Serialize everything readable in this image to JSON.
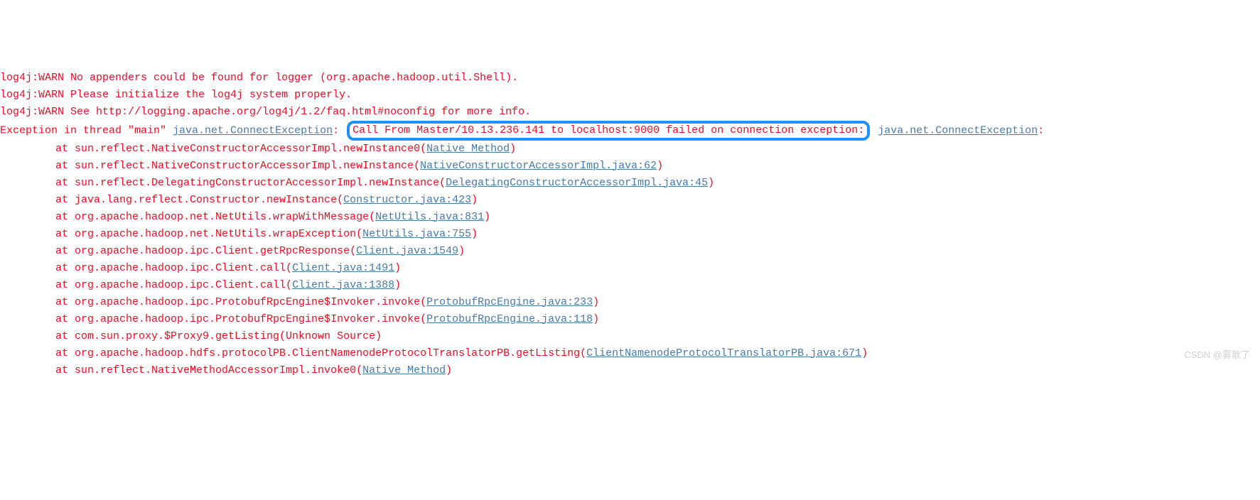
{
  "lines": {
    "warn1": "log4j:WARN No appenders could be found for logger (org.apache.hadoop.util.Shell).",
    "warn2": "log4j:WARN Please initialize the log4j system properly.",
    "warn3": "log4j:WARN See http://logging.apache.org/log4j/1.2/faq.html#noconfig for more info.",
    "exception": {
      "prefix": "Exception in thread \"main\" ",
      "link1": "java.net.ConnectException",
      "colon1": ": ",
      "highlighted": "Call From Master/10.13.236.141 to localhost:9000 failed on connection exception:",
      "space": " ",
      "link2": "java.net.ConnectException",
      "colon2": ":"
    },
    "stack": [
      {
        "at": "at sun.reflect.NativeConstructorAccessorImpl.newInstance0(",
        "link": "Native Method",
        "close": ")"
      },
      {
        "at": "at sun.reflect.NativeConstructorAccessorImpl.newInstance(",
        "link": "NativeConstructorAccessorImpl.java:62",
        "close": ")"
      },
      {
        "at": "at sun.reflect.DelegatingConstructorAccessorImpl.newInstance(",
        "link": "DelegatingConstructorAccessorImpl.java:45",
        "close": ")"
      },
      {
        "at": "at java.lang.reflect.Constructor.newInstance(",
        "link": "Constructor.java:423",
        "close": ")"
      },
      {
        "at": "at org.apache.hadoop.net.NetUtils.wrapWithMessage(",
        "link": "NetUtils.java:831",
        "close": ")"
      },
      {
        "at": "at org.apache.hadoop.net.NetUtils.wrapException(",
        "link": "NetUtils.java:755",
        "close": ")"
      },
      {
        "at": "at org.apache.hadoop.ipc.Client.getRpcResponse(",
        "link": "Client.java:1549",
        "close": ")"
      },
      {
        "at": "at org.apache.hadoop.ipc.Client.call(",
        "link": "Client.java:1491",
        "close": ")"
      },
      {
        "at": "at org.apache.hadoop.ipc.Client.call(",
        "link": "Client.java:1388",
        "close": ")"
      },
      {
        "at": "at org.apache.hadoop.ipc.ProtobufRpcEngine$Invoker.invoke(",
        "link": "ProtobufRpcEngine.java:233",
        "close": ")"
      },
      {
        "at": "at org.apache.hadoop.ipc.ProtobufRpcEngine$Invoker.invoke(",
        "link": "ProtobufRpcEngine.java:118",
        "close": ")"
      },
      {
        "at": "at com.sun.proxy.$Proxy9.getListing(Unknown Source)",
        "link": "",
        "close": ""
      },
      {
        "at": "at org.apache.hadoop.hdfs.protocolPB.ClientNamenodeProtocolTranslatorPB.getListing(",
        "link": "ClientNamenodeProtocolTranslatorPB.java:671",
        "close": ")"
      },
      {
        "at": "at sun.reflect.NativeMethodAccessorImpl.invoke0(",
        "link": "Native Method",
        "close": ")"
      }
    ]
  },
  "watermark": "CSDN @雾散了"
}
